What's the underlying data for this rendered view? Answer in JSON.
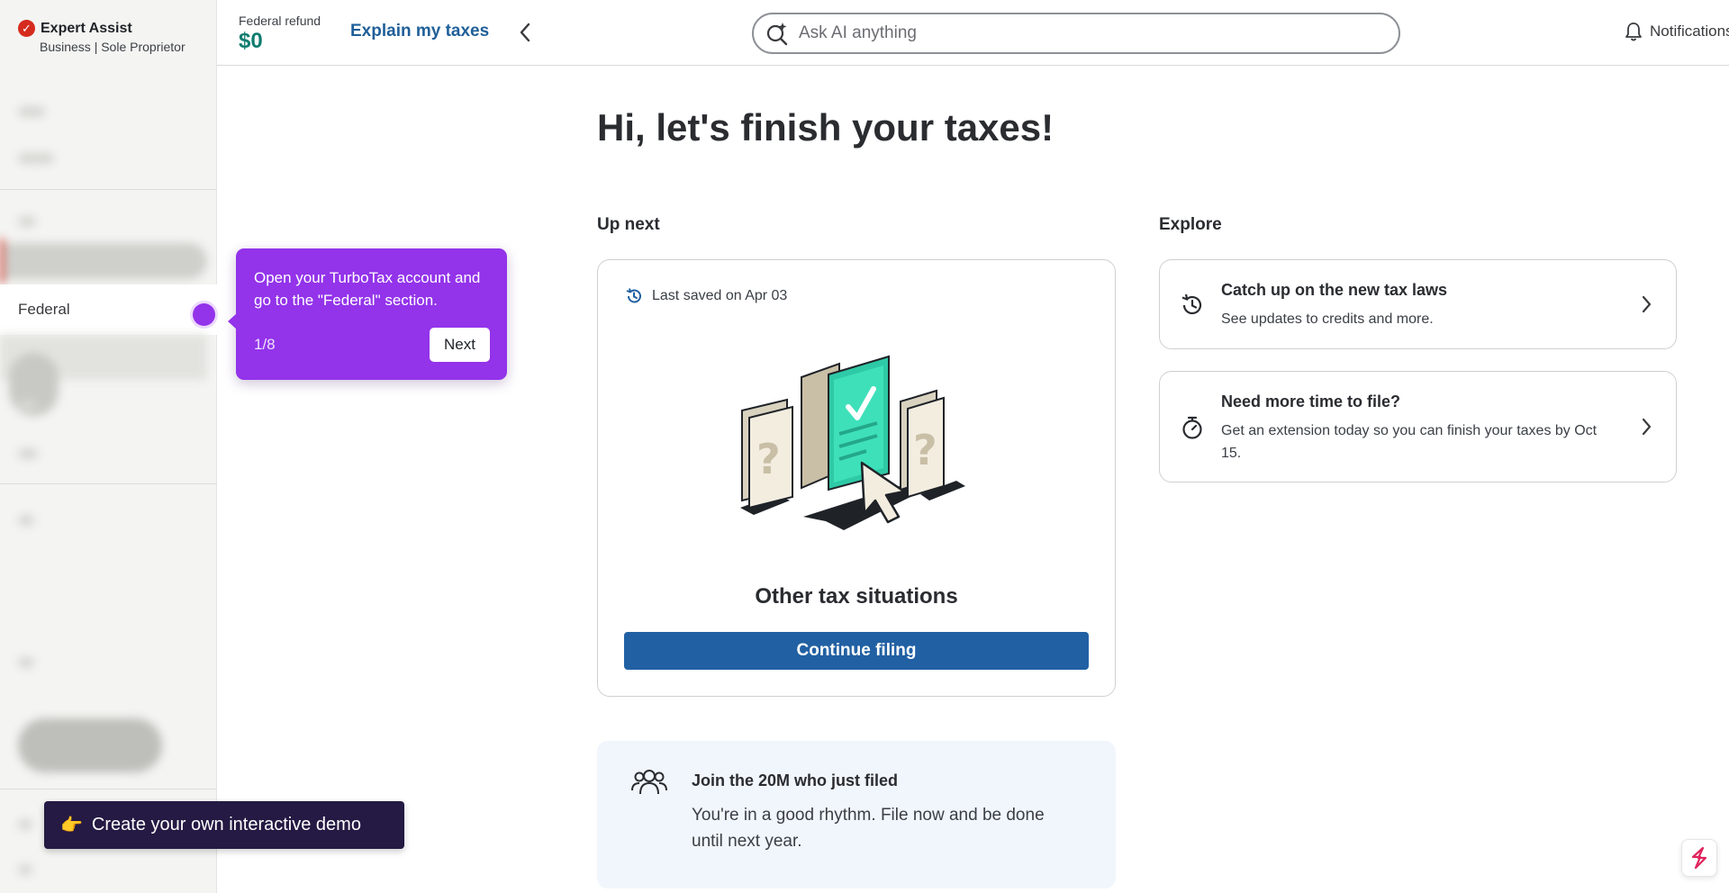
{
  "brand": {
    "title": "Expert Assist",
    "subtitle": "Business | Sole Proprietor"
  },
  "header": {
    "refund_label": "Federal refund",
    "refund_amount": "$0",
    "explain_link": "Explain my taxes",
    "search_placeholder": "Ask AI anything",
    "notifications_label": "Notifications"
  },
  "sidebar": {
    "active_item": "Federal"
  },
  "main": {
    "greeting": "Hi, let's finish your taxes!",
    "up_next_heading": "Up next",
    "explore_heading": "Explore",
    "next_card": {
      "saved_text": "Last saved on Apr 03",
      "situation_title": "Other tax situations",
      "continue_label": "Continue filing"
    },
    "join_card": {
      "title": "Join the 20M who just filed",
      "body": "You're in a good rhythm. File now and be done until next year."
    },
    "explore_cards": [
      {
        "title": "Catch up on the new tax laws",
        "description": "See updates to credits and more.",
        "icon": "history-icon"
      },
      {
        "title": "Need more time to file?",
        "description": "Get an extension today so you can finish your taxes by Oct 15.",
        "icon": "stopwatch-icon"
      }
    ]
  },
  "tooltip": {
    "text": "Open your TurboTax account and go to the \"Federal\" section.",
    "step": "1/8",
    "next_label": "Next"
  },
  "demo_button": {
    "emoji": "👉",
    "label": "Create your own interactive demo"
  },
  "colors": {
    "brand_red": "#d52b1e",
    "refund_green": "#0f7d70",
    "link_blue": "#1f5f99",
    "primary_button": "#2160a3",
    "tooltip_purple": "#9333ea",
    "demo_button_bg": "#241a43",
    "join_card_bg": "#f1f6fc"
  }
}
